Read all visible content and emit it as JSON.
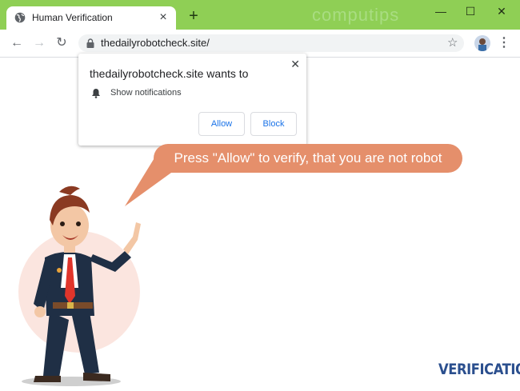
{
  "browser": {
    "tab": {
      "title": "Human Verification",
      "favicon": "globe-icon"
    },
    "watermark": "computips",
    "address": {
      "url": "thedailyrobotcheck.site/"
    },
    "window_controls": [
      "minimize-icon",
      "maximize-icon",
      "close-icon"
    ],
    "colors": {
      "titlebar": "#8fcf55",
      "omnibox": "#f1f3f4",
      "link_blue": "#1a73e8"
    }
  },
  "permission_prompt": {
    "title": "thedailyrobotcheck.site wants to",
    "permission": "Show notifications",
    "allow_label": "Allow",
    "block_label": "Block"
  },
  "page": {
    "bubble_text": "Press \"Allow\" to verify, that you are not robot",
    "brand": "VERIFICATION",
    "colors": {
      "bubble": "#e58f6b",
      "brand": "#2b4f8e",
      "tie": "#e0352b",
      "suit": "#1f2f45"
    }
  }
}
